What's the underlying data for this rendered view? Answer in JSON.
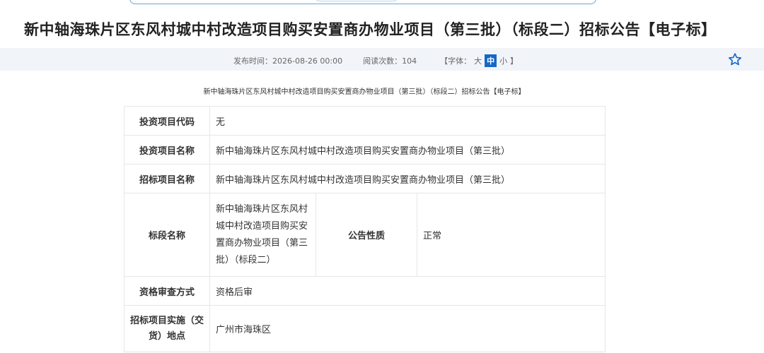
{
  "page": {
    "title": "新中轴海珠片区东风村城中村改造项目购买安置商办物业项目（第三批）（标段二）招标公告【电子标】",
    "subtitle": "新中轴海珠片区东风村城中村改造项目购买安置商办物业项目（第三批）（标段二）招标公告【电子标】"
  },
  "meta": {
    "publish_label": "发布时间：",
    "publish_time": "2026-08-26 00:00",
    "views_label": "阅读次数：",
    "views": "104",
    "font_open": "【字体：",
    "font_large": "大",
    "font_medium": "中",
    "font_small": "小",
    "font_close": "】",
    "star_color": "#1468c8"
  },
  "table": {
    "rows": [
      {
        "label": "投资项目代码",
        "value": "无"
      },
      {
        "label": "投资项目名称",
        "value": "新中轴海珠片区东风村城中村改造项目购买安置商办物业项目（第三批）"
      },
      {
        "label": "招标项目名称",
        "value": "新中轴海珠片区东风村城中村改造项目购买安置商办物业项目（第三批）"
      }
    ],
    "section": {
      "label": "标段名称",
      "value": "新中轴海珠片区东风村城中村改造项目购买安置商办物业项目（第三批）（标段二）",
      "nature_label": "公告性质",
      "nature_value": "正常"
    },
    "review": {
      "label": "资格审查方式",
      "value": "资格后审"
    },
    "location": {
      "label": "招标项目实施（交货）地点",
      "value": "广州市海珠区"
    }
  }
}
